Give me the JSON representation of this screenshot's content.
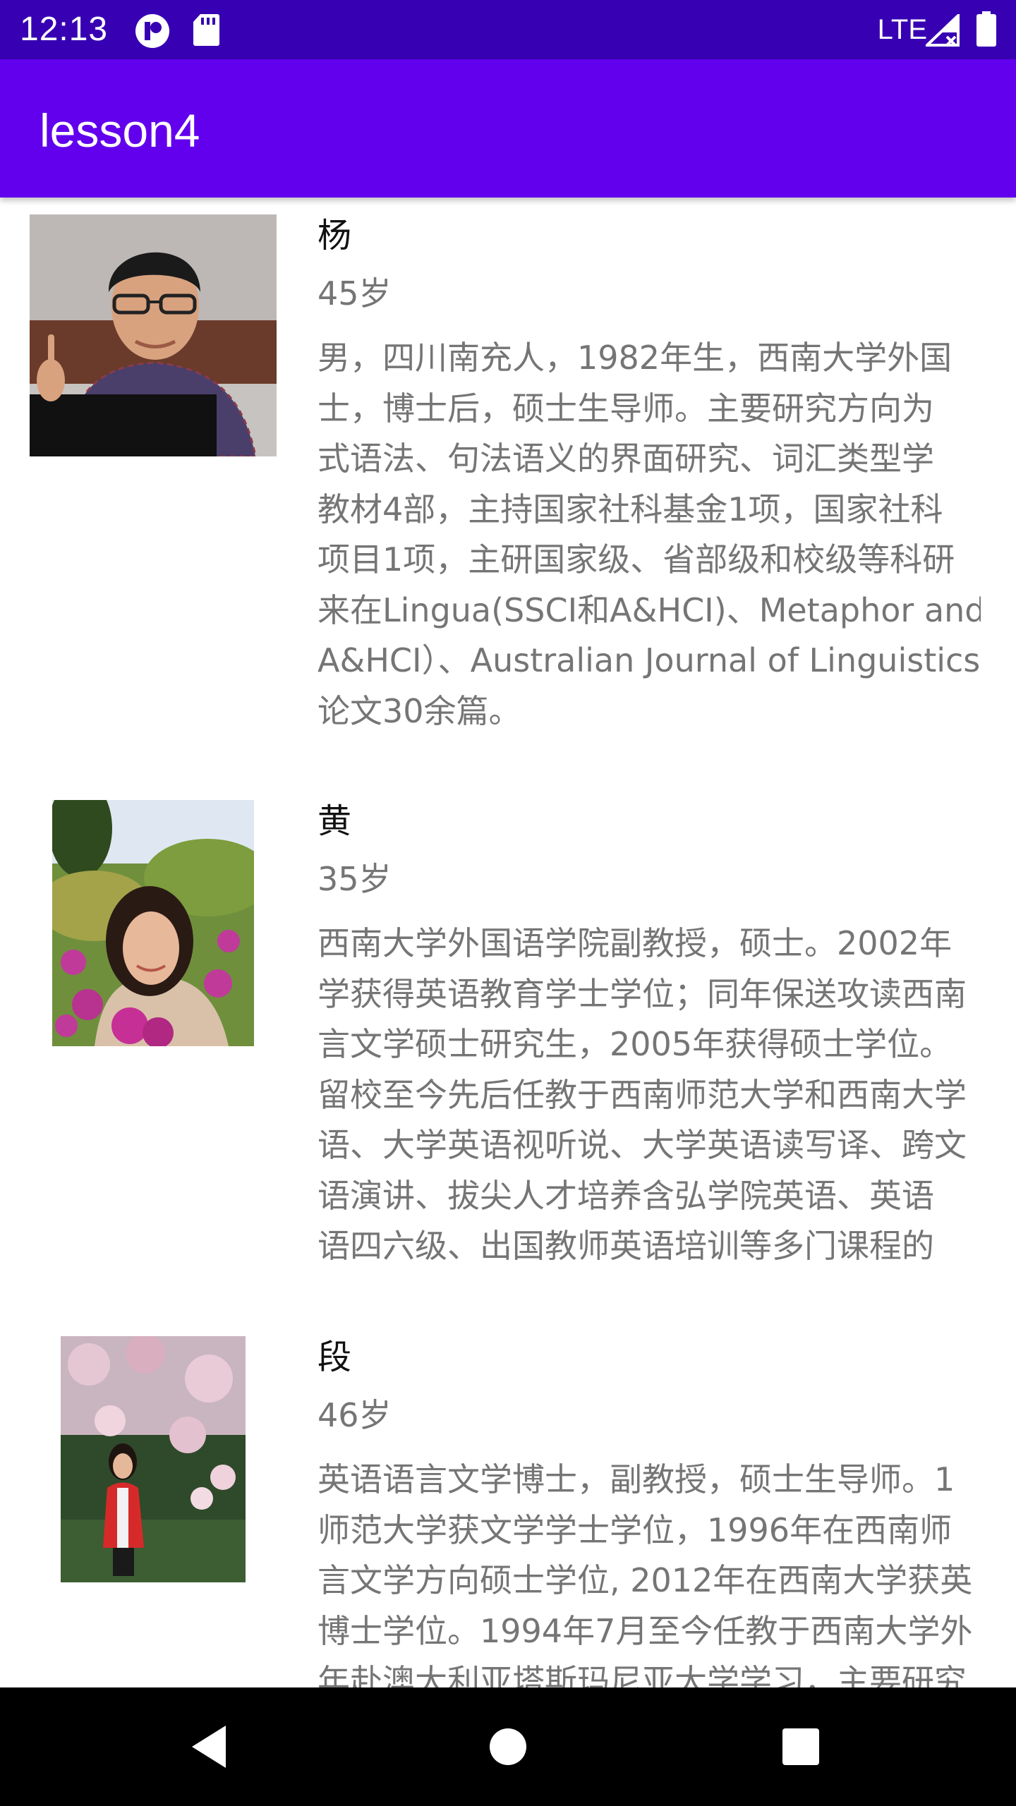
{
  "status_bar": {
    "time": "12:13",
    "network": "LTE",
    "icons": [
      "notification-icon",
      "sd-card-icon",
      "signal-icon",
      "battery-icon"
    ]
  },
  "app_bar": {
    "title": "lesson4"
  },
  "colors": {
    "status_bar": "#3700b3",
    "app_bar": "#6200ee",
    "secondary_text": "#757575"
  },
  "list": [
    {
      "name": "杨",
      "age": "45岁",
      "description_lines": [
        "男，四川南充人，1982年生，西南大学外国",
        "士，博士后，硕士生导师。主要研究方向为",
        "式语法、句法语义的界面研究、词汇类型学",
        "教材4部，主持国家社科基金1项，国家社科",
        "项目1项，主研国家级、省部级和校级等科研",
        "来在Lingua(SSCI和A&HCI)、Metaphor and",
        "A&HCI）、Australian Journal of Linguistics",
        "论文30余篇。"
      ]
    },
    {
      "name": "黄",
      "age": "35岁",
      "description_lines": [
        "西南大学外国语学院副教授，硕士。2002年",
        "学获得英语教育学士学位；同年保送攻读西南",
        "言文学硕士研究生，2005年获得硕士学位。",
        "留校至今先后任教于西南师范大学和西南大学",
        "语、大学英语视听说、大学英语读写译、跨文",
        "语演讲、拔尖人才培养含弘学院英语、英语",
        "语四六级、出国教师英语培训等多门课程的"
      ]
    },
    {
      "name": "段",
      "age": "46岁",
      "description_lines": [
        "英语语言文学博士，副教授，硕士生导师。1",
        "师范大学获文学学士学位，1996年在西南师",
        "言文学方向硕士学位, 2012年在西南大学获英",
        "博士学位。1994年7月至今任教于西南大学外",
        "年赴澳大利亚塔斯玛尼亚大学学习，主要研究"
      ]
    }
  ]
}
